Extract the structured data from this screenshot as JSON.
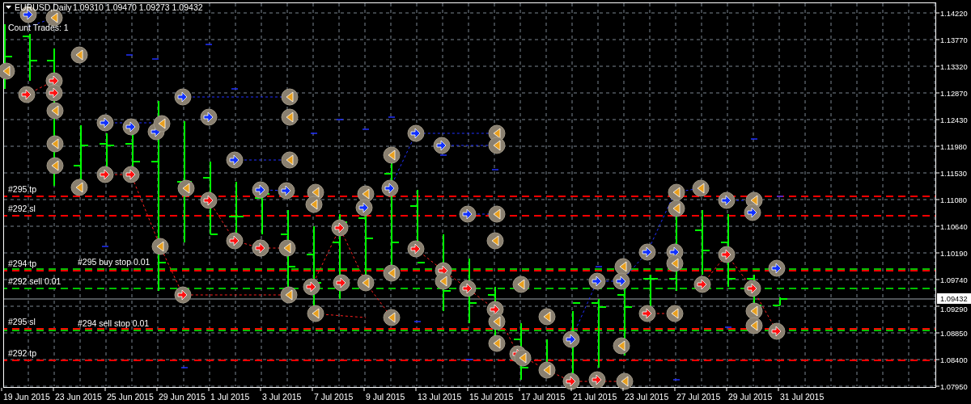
{
  "header": {
    "symbol": "EURUSD,Daily",
    "quote": "1.09310 1.09470 1.09273 1.09432"
  },
  "info": "Count Trades: 1",
  "order_lines": [
    {
      "label": "#295 tp",
      "color": "#ff0000"
    },
    {
      "label": "#292 sl",
      "color": "#ff0000"
    },
    {
      "label": "#294 tp",
      "color": "#ff0000"
    },
    {
      "label": "#295 buy stop 0.01",
      "color": "#00c000"
    },
    {
      "label": "#292 sell 0.01",
      "color": "#00c000"
    },
    {
      "label": "#295 sl",
      "color": "#ff0000"
    },
    {
      "label": "#294 sell stop 0.01",
      "color": "#00c000"
    },
    {
      "label": "#292 tp",
      "color": "#ff0000"
    }
  ],
  "price_axis": {
    "labels": [
      "1.14220",
      "1.13770",
      "1.13320",
      "1.12870",
      "1.12430",
      "1.11980",
      "1.11530",
      "1.11080",
      "1.10640",
      "1.10190",
      "1.09740",
      "1.09290",
      "1.08850",
      "1.08400",
      "1.07950"
    ],
    "current_price": "1.09432"
  },
  "time_axis": {
    "labels": [
      "19 Jun 2015",
      "23 Jun 2015",
      "25 Jun 2015",
      "29 Jun 2015",
      "1 Jul 2015",
      "3 Jul 2015",
      "7 Jul 2015",
      "9 Jul 2015",
      "13 Jul 2015",
      "15 Jul 2015",
      "17 Jul 2015",
      "21 Jul 2015",
      "23 Jul 2015",
      "27 Jul 2015",
      "29 Jul 2015",
      "31 Jul 2015"
    ]
  }
}
